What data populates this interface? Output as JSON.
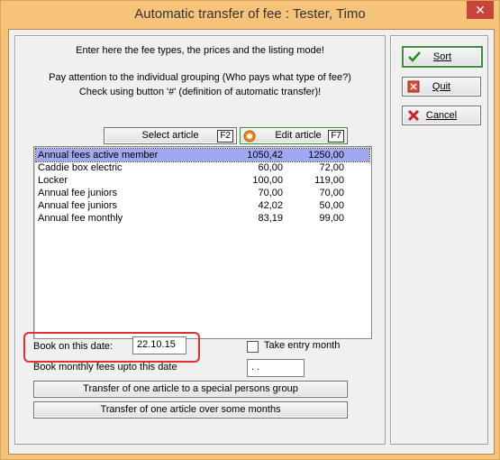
{
  "window": {
    "title": "Automatic transfer of fee : Tester, Timo",
    "close_glyph": "✕"
  },
  "info": {
    "line1": "Enter here the fee types, the prices and the listing mode!",
    "line2": "Pay attention to the individual grouping (Who pays what type of fee?)",
    "line3": "Check using button '#' (definition of automatic transfer)!"
  },
  "toolbar": {
    "select_article": "Select article",
    "select_key": "F2",
    "edit_article": "Edit article",
    "edit_key": "F7"
  },
  "articles": [
    {
      "name": "Annual fees active member",
      "price1": "1050,42",
      "price2": "1250,00",
      "selected": true
    },
    {
      "name": "Caddie box electric",
      "price1": "60,00",
      "price2": "72,00"
    },
    {
      "name": "Locker",
      "price1": "100,00",
      "price2": "119,00"
    },
    {
      "name": "Annual fee juniors",
      "price1": "70,00",
      "price2": "70,00"
    },
    {
      "name": "Annual fee juniors",
      "price1": "42,02",
      "price2": "50,00"
    },
    {
      "name": "Annual fee monthly",
      "price1": "83,19",
      "price2": "99,00"
    }
  ],
  "booking": {
    "book_date_label": "Book on this date:",
    "book_date_value": "22.10.15",
    "take_entry_month_label": "Take entry month",
    "monthly_label": "Book monthly fees upto this date",
    "monthly_value": " .  ."
  },
  "actions": {
    "transfer_group": "Transfer of one article to a special persons group",
    "transfer_months": "Transfer of one article over some months"
  },
  "side": {
    "sort": "Sort",
    "quit": "Quit",
    "cancel": "Cancel"
  },
  "colors": {
    "title_bar": "#f6c37b",
    "selection": "#9fa8f0",
    "highlight": "#e03030",
    "close": "#c8443b"
  },
  "icons": {
    "sort": "checkmark-icon",
    "quit": "exit-icon",
    "cancel": "x-icon",
    "edit": "radio-circle-icon"
  }
}
